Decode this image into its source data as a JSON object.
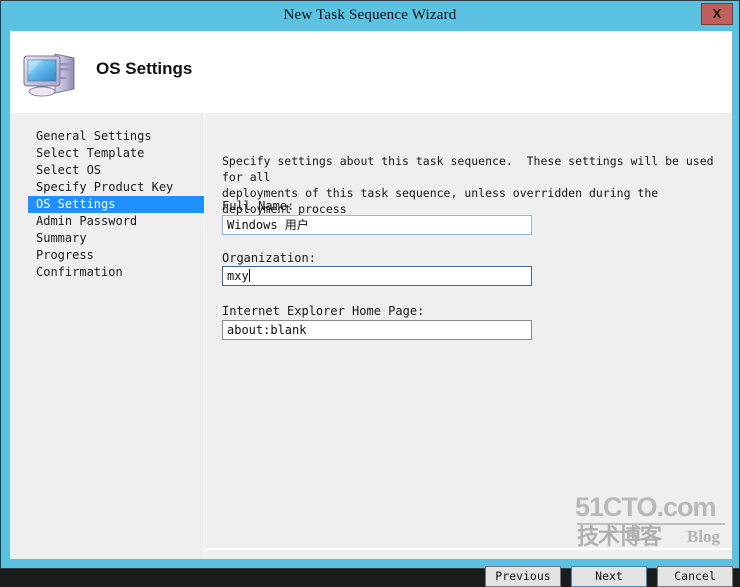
{
  "window": {
    "title": "New Task Sequence Wizard",
    "close_label": "X",
    "frame_color": "#5bc2e2"
  },
  "header": {
    "page_title": "OS Settings",
    "icon": "computer-icon"
  },
  "sidebar": {
    "active_index": 4,
    "highlight_color": "#1e90ff",
    "items": [
      {
        "label": "General Settings"
      },
      {
        "label": "Select Template"
      },
      {
        "label": "Select OS"
      },
      {
        "label": "Specify Product Key"
      },
      {
        "label": "OS Settings"
      },
      {
        "label": "Admin Password"
      },
      {
        "label": "Summary"
      },
      {
        "label": "Progress"
      },
      {
        "label": "Confirmation"
      }
    ]
  },
  "content": {
    "intro": "Specify settings about this task sequence.  These settings will be used for all\ndeployments of this task sequence, unless overridden during the deployment process",
    "fields": [
      {
        "label": "Full Name:",
        "value": "Windows 用户",
        "placeholder": "",
        "state": "normal"
      },
      {
        "label": "Organization:",
        "value": "mxy",
        "placeholder": "",
        "state": "focused"
      },
      {
        "label": "Internet Explorer Home Page:",
        "value": "about:blank",
        "placeholder": "",
        "state": "normal"
      }
    ]
  },
  "footer": {
    "previous_label": "Previous",
    "next_label": "Next",
    "cancel_label": "Cancel"
  },
  "watermark": {
    "top": "51CTO.com",
    "chinese": "技术博客",
    "blog": "Blog"
  }
}
